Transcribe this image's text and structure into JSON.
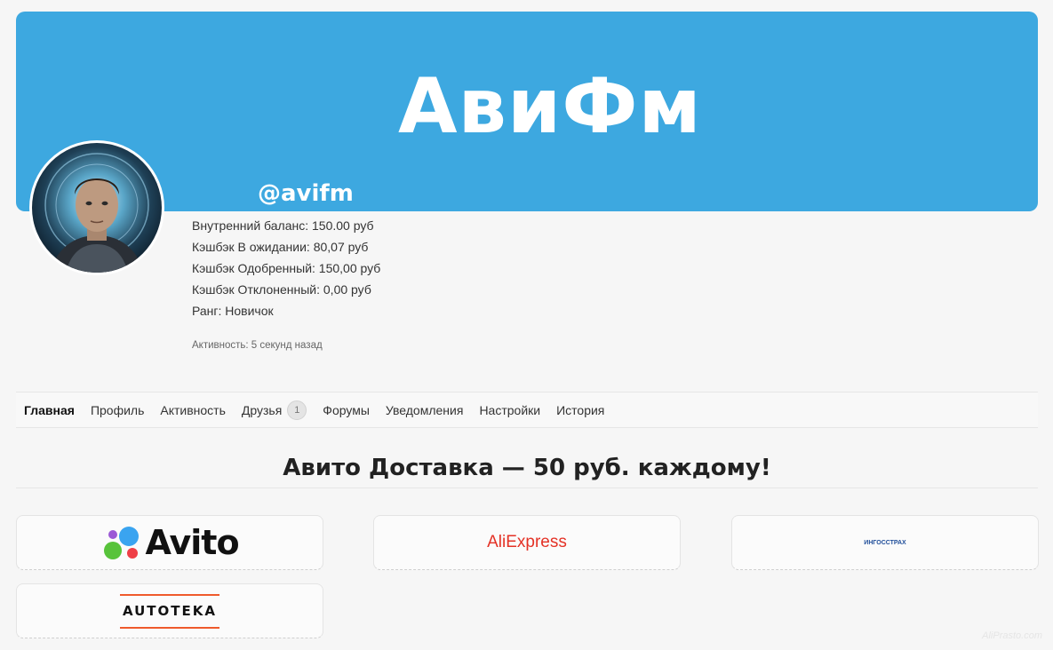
{
  "cover": {
    "title": "АвиФм",
    "username": "@avifm"
  },
  "stats": [
    "Внутренний баланс: 150.00 руб",
    "Кэшбэк В ожидании: 80,07 руб",
    "Кэшбэк Одобренный: 150,00 руб",
    "Кэшбэк Отклоненный: 0,00 руб",
    "Ранг: Новичок"
  ],
  "activity": "Активность: 5 секунд назад",
  "nav": {
    "items": [
      {
        "label": "Главная"
      },
      {
        "label": "Профиль"
      },
      {
        "label": "Активность"
      },
      {
        "label": "Друзья",
        "badge": "1"
      },
      {
        "label": "Форумы"
      },
      {
        "label": "Уведомления"
      },
      {
        "label": "Настройки"
      },
      {
        "label": "История"
      }
    ]
  },
  "promo": {
    "title": "Авито Доставка — 50 руб. каждому!"
  },
  "partners": {
    "avito": "Avito",
    "aliexpress": "AliExpress",
    "ingosstrakh": "ИНГОССТРАХ",
    "autoteka": "AUTOTEKA"
  },
  "watermark": "AliPrasto.com",
  "colors": {
    "cover": "#3da8e0",
    "aliexpress": "#e43226",
    "autoteka_accent": "#ef5a2c",
    "ingosstrakh": "#1f4e9a"
  }
}
